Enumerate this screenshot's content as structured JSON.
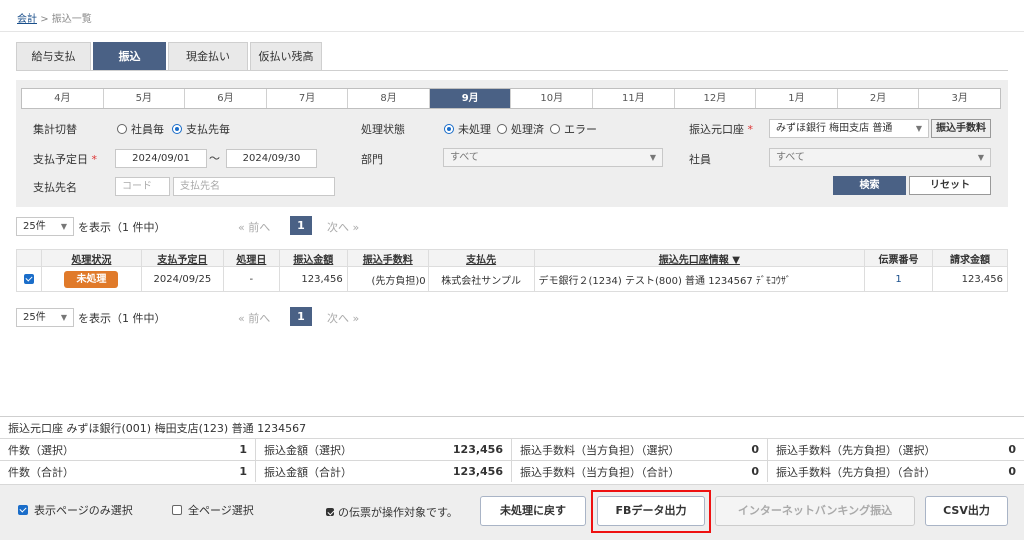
{
  "breadcrumb": {
    "root": "会計",
    "sep": ">",
    "current": "振込一覧"
  },
  "tabs": [
    "給与支払",
    "振込",
    "現金払い",
    "仮払い残高"
  ],
  "months": [
    "4月",
    "5月",
    "6月",
    "7月",
    "8月",
    "9月",
    "10月",
    "11月",
    "12月",
    "1月",
    "2月",
    "3月"
  ],
  "filters": {
    "aggregate_label": "集計切替",
    "aggregate_opt1": "社員毎",
    "aggregate_opt2": "支払先毎",
    "status_label": "処理状態",
    "status_opt1": "未処理",
    "status_opt2": "処理済",
    "status_opt3": "エラー",
    "source_label": "振込元口座",
    "source_value": "みずほ銀行 梅田支店 普通",
    "fee_button": "振込手数料",
    "date_label": "支払予定日",
    "required_mark": "*",
    "date_from": "2024/09/01",
    "date_tilde": "〜",
    "date_to": "2024/09/30",
    "dept_label": "部門",
    "dept_value": "すべて",
    "employee_label": "社員",
    "employee_value": "すべて",
    "payee_label": "支払先名",
    "code_placeholder": "コード",
    "payee_placeholder": "支払先名",
    "search_button": "検索",
    "reset_button": "リセット"
  },
  "pager": {
    "per_page": "25件",
    "display_text": "を表示（1 件中）",
    "prev": "« 前へ",
    "page": "1",
    "next": "次へ »"
  },
  "table": {
    "headers": [
      "処理状況",
      "支払予定日",
      "処理日",
      "振込金額",
      "振込手数料",
      "支払先",
      "振込先口座情報 ▼",
      "伝票番号",
      "請求金額"
    ],
    "row": {
      "status": "未処理",
      "scheduled": "2024/09/25",
      "processed": "-",
      "amount": "123,456",
      "fee": "(先方負担)0",
      "payee": "株式会社サンプル",
      "account": "デモ銀行２(1234) テスト(800) 普通 1234567 ﾃﾞﾓｺｳｻﾞ",
      "slip": "1",
      "invoice": "123,456"
    }
  },
  "summary": {
    "account_line": "振込元口座 みずほ銀行(001) 梅田支店(123) 普通 1234567",
    "row1": [
      {
        "label": "件数（選択）",
        "value": "1"
      },
      {
        "label": "振込金額（選択）",
        "value": "123,456"
      },
      {
        "label": "振込手数料（当方負担）（選択）",
        "value": "0"
      },
      {
        "label": "振込手数料（先方負担）（選択）",
        "value": "0"
      }
    ],
    "row2": [
      {
        "label": "件数（合計）",
        "value": "1"
      },
      {
        "label": "振込金額（合計）",
        "value": "123,456"
      },
      {
        "label": "振込手数料（当方負担）（合計）",
        "value": "0"
      },
      {
        "label": "振込手数料（先方負担）（合計）",
        "value": "0"
      }
    ]
  },
  "footer": {
    "select_page": "表示ページのみ選択",
    "select_all": "全ページ選択",
    "note": "の伝票が操作対象です。",
    "revert_button": "未処理に戻す",
    "fb_button": "FBデータ出力",
    "banking_button": "インターネットバンキング振込",
    "csv_button": "CSV出力"
  },
  "colors": {
    "accent": "#4a6185",
    "badge": "#e07a2a",
    "highlight": "#e11111"
  }
}
